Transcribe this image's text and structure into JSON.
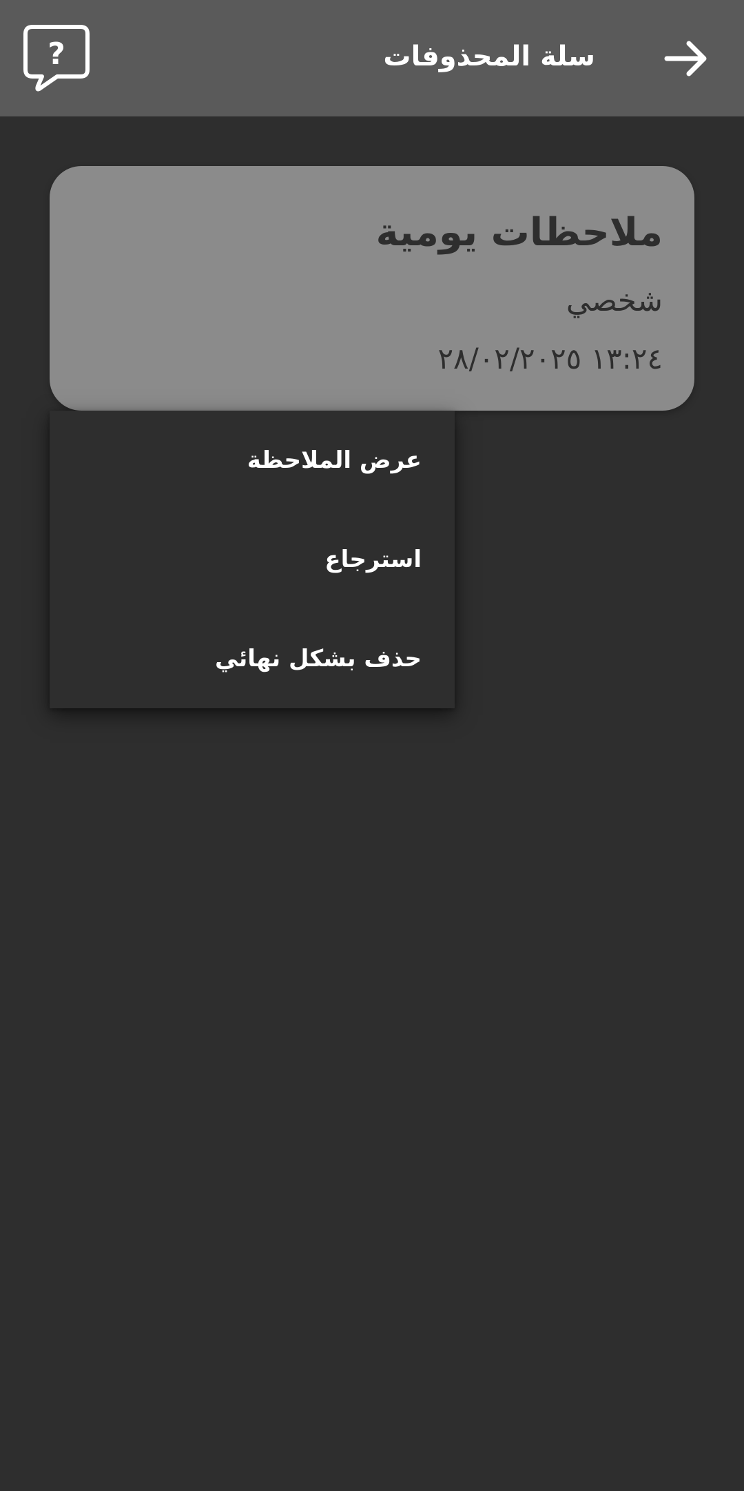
{
  "header": {
    "title": "سلة المحذوفات",
    "back_icon": "arrow-right-icon",
    "help_icon": "help-speech-bubble-icon"
  },
  "note": {
    "title": "ملاحظات يومية",
    "category": "شخصي",
    "datetime": "١٣:٢٤ ٢٨/٠٢/٢٠٢٥"
  },
  "menu": {
    "items": [
      {
        "label": "عرض الملاحظة"
      },
      {
        "label": "استرجاع"
      },
      {
        "label": "حذف بشكل نهائي"
      }
    ]
  },
  "colors": {
    "background": "#2e2e2e",
    "header": "#5a5a5a",
    "card": "#8b8b8b",
    "text_light": "#ffffff",
    "text_dark": "#2e2e2e"
  }
}
